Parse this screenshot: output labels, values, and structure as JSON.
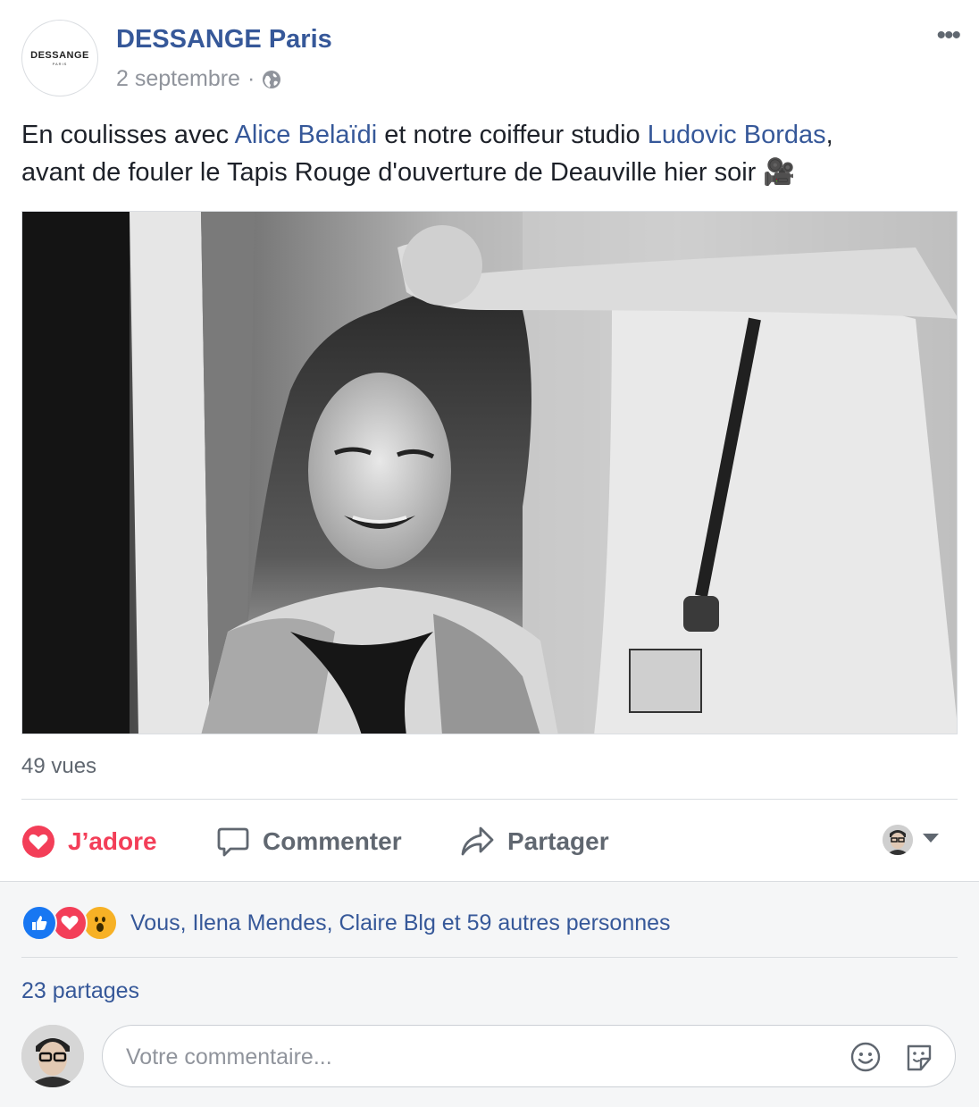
{
  "post": {
    "page_name": "DESSANGE Paris",
    "logo_text": "DESSANGE",
    "logo_sub": "PARIS",
    "date": "2 septembre",
    "separator": "·",
    "more_label": "•••",
    "text_part1": "En coulisses avec ",
    "mention1": "Alice Belaïdi",
    "text_part2": " et notre coiffeur studio ",
    "mention2": "Ludovic Bordas",
    "text_part3": ",\navant de fouler le Tapis Rouge d'ouverture de Deauville hier soir ",
    "text_emoji": "🎥",
    "views": "49 vues"
  },
  "actions": {
    "love_label": "J’adore",
    "comment_label": "Commenter",
    "share_label": "Partager"
  },
  "footer": {
    "reactions_text": "Vous, Ilena Mendes, Claire Blg et 59 autres personnes",
    "shares_text": "23 partages",
    "comment_placeholder": "Votre commentaire..."
  },
  "colors": {
    "link": "#365899",
    "love": "#f33e58",
    "like": "#1877f2",
    "wow": "#f7b125"
  },
  "icons": [
    "globe-icon",
    "more-icon",
    "heart-icon",
    "comment-icon",
    "share-icon",
    "chevron-down-icon",
    "like-reaction-icon",
    "love-reaction-icon",
    "wow-reaction-icon",
    "emoji-icon",
    "sticker-icon",
    "movie-camera-icon"
  ]
}
